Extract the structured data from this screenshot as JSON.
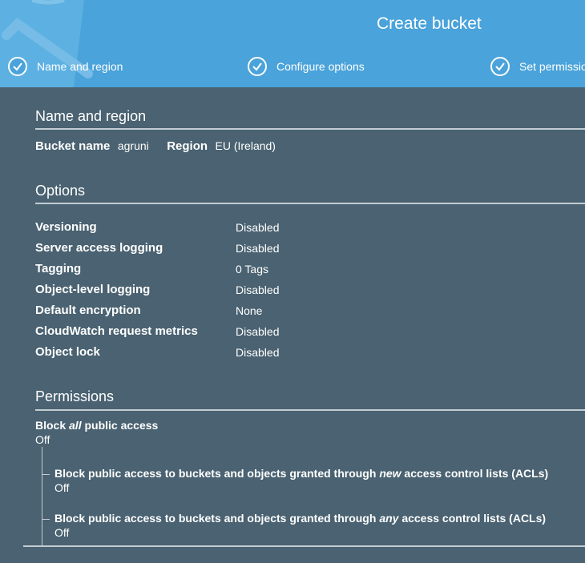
{
  "wizard": {
    "title": "Create bucket",
    "steps": [
      {
        "label": "Name and region"
      },
      {
        "label": "Configure options"
      },
      {
        "label": "Set permissio"
      }
    ]
  },
  "name_region": {
    "heading": "Name and region",
    "bucket_name_label": "Bucket name",
    "bucket_name_value": "agruni",
    "region_label": "Region",
    "region_value": "EU (Ireland)"
  },
  "options": {
    "heading": "Options",
    "rows": [
      {
        "label": "Versioning",
        "value": "Disabled"
      },
      {
        "label": "Server access logging",
        "value": "Disabled"
      },
      {
        "label": "Tagging",
        "value": "0 Tags"
      },
      {
        "label": "Object-level logging",
        "value": "Disabled"
      },
      {
        "label": "Default encryption",
        "value": "None"
      },
      {
        "label": "CloudWatch request metrics",
        "value": "Disabled"
      },
      {
        "label": "Object lock",
        "value": "Disabled"
      }
    ]
  },
  "permissions": {
    "heading": "Permissions",
    "block_all": {
      "prefix": "Block ",
      "emphasis": "all",
      "suffix": " public access",
      "value": "Off"
    },
    "sub": [
      {
        "prefix": "Block public access to buckets and objects granted through ",
        "emphasis": "new",
        "suffix": " access control lists (ACLs)",
        "value": "Off"
      },
      {
        "prefix": "Block public access to buckets and objects granted through ",
        "emphasis": "any",
        "suffix": " access control lists (ACLs)",
        "value": "Off"
      }
    ]
  },
  "colors": {
    "header_bg": "#4aa3da",
    "page_bg": "#4a6271",
    "rule": "#c3ccd2"
  }
}
